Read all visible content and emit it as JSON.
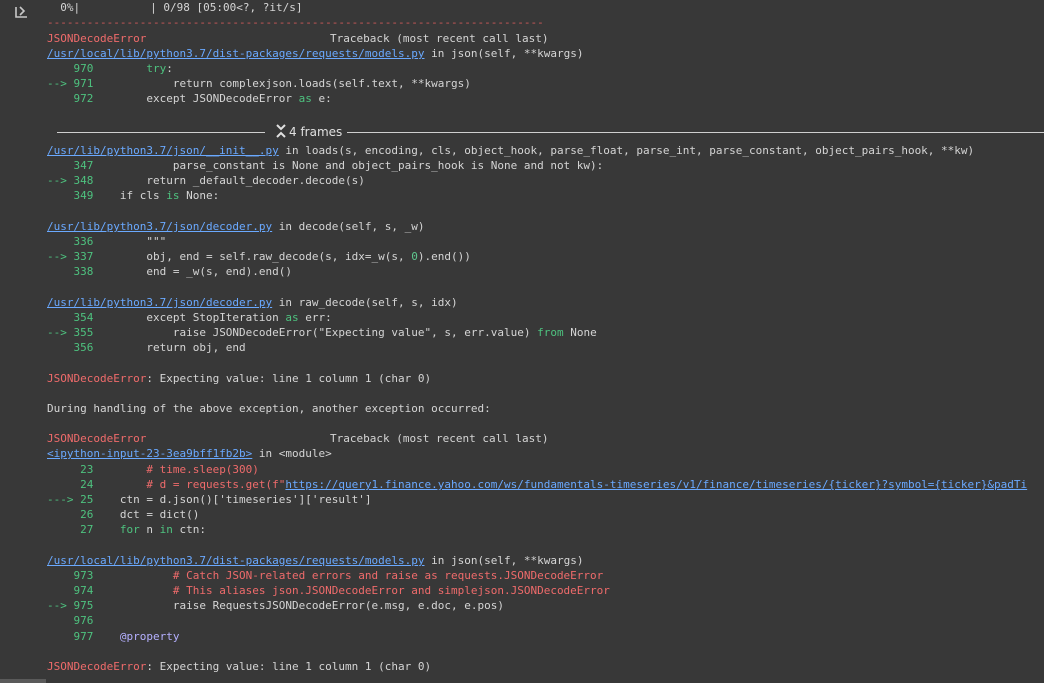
{
  "progress": {
    "percent_text": "  0%|",
    "stats_text": "| 0/98 [05:00<?, ?it/s]",
    "value": 0
  },
  "separator": "---------------------------------------------------------------------------",
  "tb1": {
    "error_name": "JSONDecodeError",
    "header_right": "Traceback (most recent call last)",
    "file": "/usr/local/lib/python3.7/dist-packages/requests/models.py",
    "in_func": " in json(self, **kwargs)",
    "lines": [
      {
        "num": "    970",
        "code": "        ",
        "kw": "try",
        "rest": ":"
      },
      {
        "num": "--> 971",
        "code": "            return complexjson.loads(self.text, **kwargs)"
      },
      {
        "num": "    972",
        "code": "        except JSONDecodeError ",
        "kw": "as",
        "rest": " e:"
      }
    ]
  },
  "frames_label": "4 frames",
  "f1": {
    "file": "/usr/lib/python3.7/json/__init__.py",
    "in_func": " in loads(s, encoding, cls, object_hook, parse_float, parse_int, parse_constant, object_pairs_hook, **kw)",
    "l1_num": "    347",
    "l1_code": "            parse_constant is None and object_pairs_hook is None and not kw):",
    "l2_num": "--> 348",
    "l2_code": "        return _default_decoder.decode(s)",
    "l3_num": "    349",
    "l3_a": "    if cls ",
    "l3_kw": "is",
    "l3_b": " None:"
  },
  "f2": {
    "file": "/usr/lib/python3.7/json/decoder.py",
    "in_func": " in decode(self, s, _w)",
    "l1_num": "    336",
    "l1_code": "        \"\"\"",
    "l2_num": "--> 337",
    "l2_a": "        obj, end = self.raw_decode(s, idx=_w(s, ",
    "l2_n": "0",
    "l2_b": ").end())",
    "l3_num": "    338",
    "l3_code": "        end = _w(s, end).end()"
  },
  "f3": {
    "file": "/usr/lib/python3.7/json/decoder.py",
    "in_func": " in raw_decode(self, s, idx)",
    "l1_num": "    354",
    "l1_a": "        except StopIteration ",
    "l1_kw": "as",
    "l1_b": " err:",
    "l2_num": "--> 355",
    "l2_a": "            raise JSONDecodeError(\"Expecting value\", s, err.value) ",
    "l2_kw": "from",
    "l2_b": " None",
    "l3_num": "    356",
    "l3_code": "        return obj, end"
  },
  "err1": {
    "name": "JSONDecodeError",
    "msg": ": Expecting value: line 1 column 1 (char 0)"
  },
  "during": "During handling of the above exception, another exception occurred:",
  "tb2": {
    "error_name": "JSONDecodeError",
    "header_right": "Traceback (most recent call last)",
    "file": "<ipython-input-23-3ea9bff1fb2b>",
    "in_func": " in <module>",
    "l23_num": "     23",
    "l23_code": "        # time.sleep(300)",
    "l24_num": "     24",
    "l24_a": "        # d = requests.get(f\"",
    "l24_link": "https://query1.finance.yahoo.com/ws/fundamentals-timeseries/v1/finance/timeseries/{ticker}?symbol={ticker}&padTi",
    "l25_num": "---> 25",
    "l25_code": "    ctn = d.json()['timeseries']['result']",
    "l26_num": "     26",
    "l26_code": "    dct = dict()",
    "l27_num": "     27",
    "l27_kw": "    for",
    "l27_a": " n ",
    "l27_kw2": "in",
    "l27_b": " ctn:"
  },
  "f4": {
    "file": "/usr/local/lib/python3.7/dist-packages/requests/models.py",
    "in_func": " in json(self, **kwargs)",
    "l1_num": "    973",
    "l1_code": "            # Catch JSON-related errors and raise as requests.JSONDecodeError",
    "l2_num": "    974",
    "l2_code": "            # This aliases json.JSONDecodeError and simplejson.JSONDecodeError",
    "l3_num": "--> 975",
    "l3_code": "            raise RequestsJSONDecodeError(e.msg, e.doc, e.pos)",
    "l4_num": "    976",
    "l4_code": "",
    "l5_num": "    977",
    "l5_code": "    @property"
  },
  "err2": {
    "name": "JSONDecodeError",
    "msg": ": Expecting value: line 1 column 1 (char 0)"
  },
  "colors": {
    "background": "#383838",
    "error": "#ef6b6b",
    "link": "#6aa9ff",
    "line_number": "#4ec27f"
  }
}
